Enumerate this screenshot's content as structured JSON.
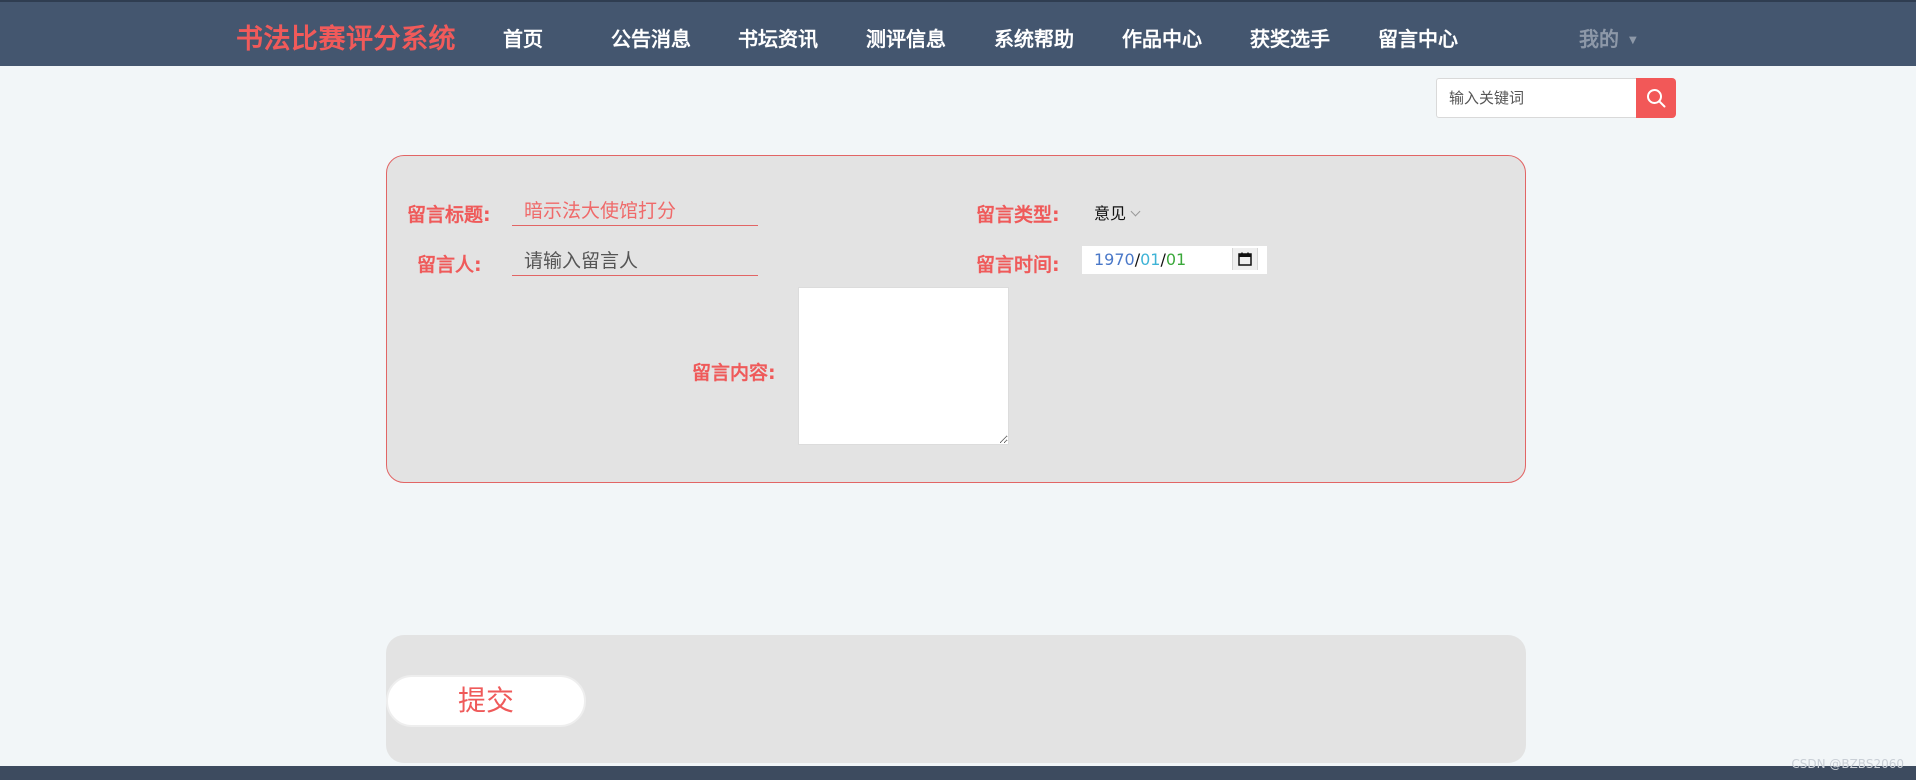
{
  "header": {
    "brand": "书法比赛评分系统",
    "nav": [
      "首页",
      "公告消息",
      "书坛资讯",
      "测评信息",
      "系统帮助",
      "作品中心",
      "获奖选手",
      "留言中心"
    ],
    "mine": "我的"
  },
  "search": {
    "placeholder": "输入关键词"
  },
  "form": {
    "title_label": "留言标题:",
    "title_placeholder": "暗示法大使馆打分",
    "type_label": "留言类型:",
    "type_value": "意见",
    "person_label": "留言人:",
    "person_placeholder": "请输入留言人",
    "time_label": "留言时间:",
    "date": {
      "year": "1970",
      "month": "01",
      "day": "01"
    },
    "content_label": "留言内容:"
  },
  "submit_label": "提交",
  "watermark": "CSDN @BZBS2060",
  "colors": {
    "navbar": "#44566f",
    "brand": "#f15a5a",
    "accent": "#f25858",
    "panel": "#e3e3e3",
    "page": "#f2f6f8"
  }
}
